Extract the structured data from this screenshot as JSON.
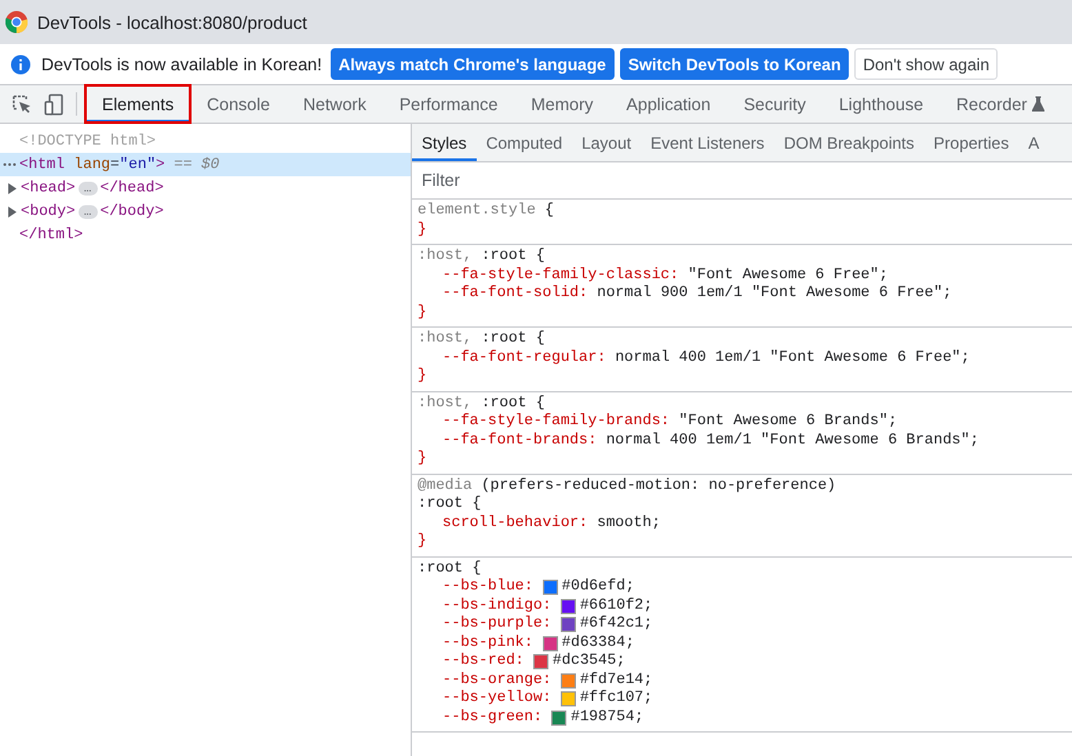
{
  "window": {
    "title": "DevTools - localhost:8080/product"
  },
  "infobar": {
    "message": "DevTools is now available in Korean!",
    "buttons": [
      {
        "label": "Always match Chrome's language",
        "kind": "primary"
      },
      {
        "label": "Switch DevTools to Korean",
        "kind": "primary"
      },
      {
        "label": "Don't show again",
        "kind": "secondary"
      }
    ]
  },
  "tabs": [
    {
      "label": "Elements",
      "selected": true,
      "highlighted": true
    },
    {
      "label": "Console",
      "selected": false,
      "highlighted": false
    },
    {
      "label": "Network",
      "selected": false,
      "highlighted": false
    },
    {
      "label": "Performance",
      "selected": false,
      "highlighted": false
    },
    {
      "label": "Memory",
      "selected": false,
      "highlighted": false
    },
    {
      "label": "Application",
      "selected": false,
      "highlighted": false
    },
    {
      "label": "Security",
      "selected": false,
      "highlighted": false
    },
    {
      "label": "Lighthouse",
      "selected": false,
      "highlighted": false
    },
    {
      "label": "Recorder",
      "selected": false,
      "highlighted": false,
      "experimental": true
    }
  ],
  "dom": [
    {
      "selected": false,
      "segments": [
        {
          "kind": "comment",
          "text": "<!DOCTYPE html>"
        }
      ]
    },
    {
      "selected": true,
      "segments": [
        {
          "kind": "tag",
          "text": "<html"
        },
        {
          "kind": "attr-name",
          "text": " lang"
        },
        {
          "kind": "plain",
          "text": "="
        },
        {
          "kind": "attr-value",
          "text": "\"en\""
        },
        {
          "kind": "tag",
          "text": ">"
        },
        {
          "kind": "ref",
          "text": " == $0"
        }
      ]
    },
    {
      "selected": false,
      "expanded": false,
      "segments": [
        {
          "kind": "tag",
          "text": "<head>"
        },
        {
          "kind": "ellipsis",
          "text": "…"
        },
        {
          "kind": "tag",
          "text": "</head>"
        }
      ]
    },
    {
      "selected": false,
      "expanded": false,
      "segments": [
        {
          "kind": "tag",
          "text": "<body>"
        },
        {
          "kind": "ellipsis",
          "text": "…"
        },
        {
          "kind": "tag",
          "text": "</body>"
        }
      ]
    },
    {
      "selected": false,
      "segments": [
        {
          "kind": "tag",
          "text": "</html>"
        }
      ]
    }
  ],
  "subtabs": [
    {
      "label": "Styles",
      "selected": true
    },
    {
      "label": "Computed",
      "selected": false
    },
    {
      "label": "Layout",
      "selected": false
    },
    {
      "label": "Event Listeners",
      "selected": false
    },
    {
      "label": "DOM Breakpoints",
      "selected": false
    },
    {
      "label": "Properties",
      "selected": false
    },
    {
      "label": "A",
      "selected": false
    }
  ],
  "filter": {
    "placeholder": "Filter"
  },
  "rules": [
    {
      "selectors": [
        {
          "text": "element.style",
          "matched": false
        }
      ],
      "open": "{",
      "close": "}"
    },
    {
      "selectors": [
        {
          "text": ":host,",
          "matched": false
        },
        {
          "text": ":root",
          "matched": true
        }
      ],
      "open": "{",
      "declarations": [
        {
          "property": "--fa-style-family-classic:",
          "value": "\"Font Awesome 6 Free\";"
        },
        {
          "property": "--fa-font-solid:",
          "value": "normal 900 1em/1 \"Font Awesome 6 Free\";"
        }
      ],
      "close": "}"
    },
    {
      "selectors": [
        {
          "text": ":host,",
          "matched": false
        },
        {
          "text": ":root",
          "matched": true
        }
      ],
      "open": "{",
      "declarations": [
        {
          "property": "--fa-font-regular:",
          "value": "normal 400 1em/1 \"Font Awesome 6 Free\";"
        }
      ],
      "close": "}"
    },
    {
      "selectors": [
        {
          "text": ":host,",
          "matched": false
        },
        {
          "text": ":root",
          "matched": true
        }
      ],
      "open": "{",
      "declarations": [
        {
          "property": "--fa-style-family-brands:",
          "value": "\"Font Awesome 6 Brands\";"
        },
        {
          "property": "--fa-font-brands:",
          "value": "normal 400 1em/1 \"Font Awesome 6 Brands\";"
        }
      ],
      "close": "}"
    },
    {
      "media": {
        "keyword": "@media",
        "query": "(prefers-reduced-motion: no-preference)"
      },
      "selectors": [
        {
          "text": ":root",
          "matched": true
        }
      ],
      "open": "{",
      "declarations": [
        {
          "property": "scroll-behavior:",
          "value": "smooth;"
        }
      ],
      "close": "}"
    },
    {
      "selectors": [
        {
          "text": ":root",
          "matched": true
        }
      ],
      "open": "{",
      "declarations": [
        {
          "property": "--bs-blue:",
          "value": "#0d6efd;",
          "color": "#0d6efd"
        },
        {
          "property": "--bs-indigo:",
          "value": "#6610f2;",
          "color": "#6610f2"
        },
        {
          "property": "--bs-purple:",
          "value": "#6f42c1;",
          "color": "#6f42c1"
        },
        {
          "property": "--bs-pink:",
          "value": "#d63384;",
          "color": "#d63384"
        },
        {
          "property": "--bs-red:",
          "value": "#dc3545;",
          "color": "#dc3545"
        },
        {
          "property": "--bs-orange:",
          "value": "#fd7e14;",
          "color": "#fd7e14"
        },
        {
          "property": "--bs-yellow:",
          "value": "#ffc107;",
          "color": "#ffc107"
        },
        {
          "property": "--bs-green:",
          "value": "#198754;",
          "color": "#198754"
        }
      ]
    }
  ]
}
